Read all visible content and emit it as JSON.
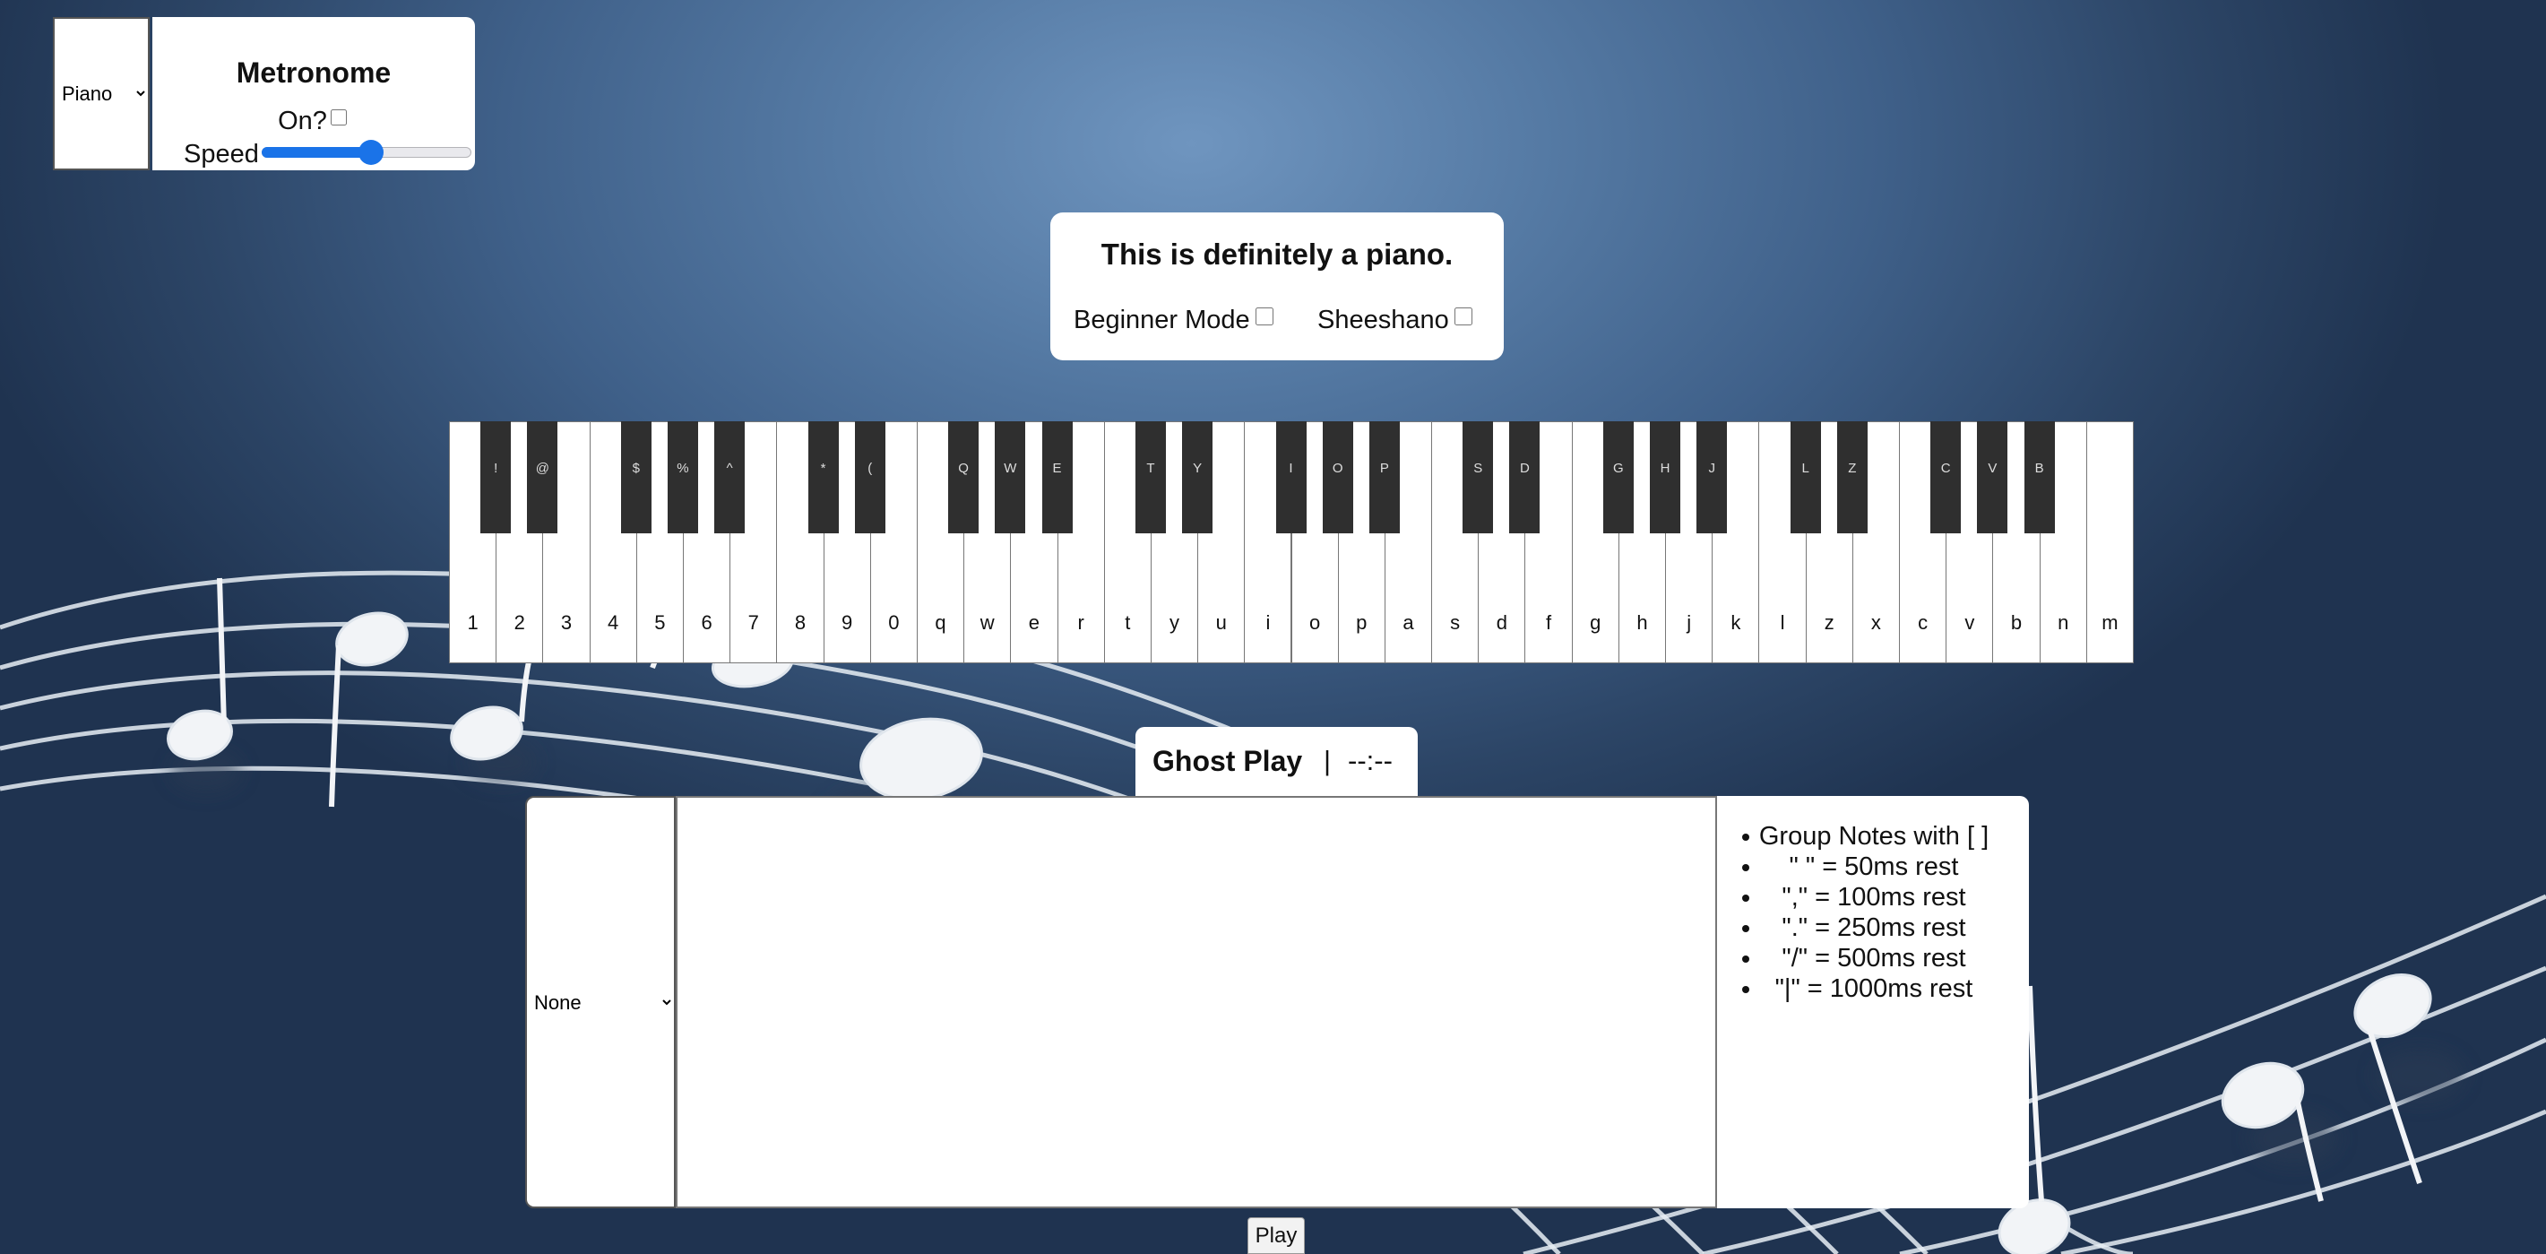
{
  "instrument_select": {
    "value": "Piano",
    "options": [
      "Piano"
    ]
  },
  "metronome": {
    "title": "Metronome",
    "on_label": "On?",
    "on_checked": false,
    "speed_label": "Speed",
    "speed_level": 0.52
  },
  "title_card": {
    "title": "This is definitely a piano.",
    "beginner_mode_label": "Beginner Mode",
    "sheeshano_label": "Sheeshano"
  },
  "piano": {
    "white_keys": [
      "1",
      "2",
      "3",
      "4",
      "5",
      "6",
      "7",
      "8",
      "9",
      "0",
      "q",
      "w",
      "e",
      "r",
      "t",
      "y",
      "u",
      "i",
      "o",
      "p",
      "a",
      "s",
      "d",
      "f",
      "g",
      "h",
      "j",
      "k",
      "l",
      "z",
      "x",
      "c",
      "v",
      "b",
      "n",
      "m"
    ],
    "black_keys": [
      {
        "label": "!",
        "after": 0
      },
      {
        "label": "@",
        "after": 1
      },
      {
        "label": "$",
        "after": 3
      },
      {
        "label": "%",
        "after": 4
      },
      {
        "label": "^",
        "after": 5
      },
      {
        "label": "*",
        "after": 7
      },
      {
        "label": "(",
        "after": 8
      },
      {
        "label": "Q",
        "after": 10
      },
      {
        "label": "W",
        "after": 11
      },
      {
        "label": "E",
        "after": 12
      },
      {
        "label": "T",
        "after": 14
      },
      {
        "label": "Y",
        "after": 15
      },
      {
        "label": "I",
        "after": 17
      },
      {
        "label": "O",
        "after": 18
      },
      {
        "label": "P",
        "after": 19
      },
      {
        "label": "S",
        "after": 21
      },
      {
        "label": "D",
        "after": 22
      },
      {
        "label": "G",
        "after": 24
      },
      {
        "label": "H",
        "after": 25
      },
      {
        "label": "J",
        "after": 26
      },
      {
        "label": "L",
        "after": 28
      },
      {
        "label": "Z",
        "after": 29
      },
      {
        "label": "C",
        "after": 31
      },
      {
        "label": "V",
        "after": 32
      },
      {
        "label": "B",
        "after": 33
      }
    ]
  },
  "ghost_play": {
    "title": "Ghost Play",
    "separator": "|",
    "time": "--:--",
    "song_select_value": "None",
    "notes_value": "",
    "legend": [
      "Group Notes with [ ]",
      "\" \" = 50ms rest",
      "\",\" = 100ms rest",
      "\".\" = 250ms rest",
      "\"/\" = 500ms rest",
      "\"|\" = 1000ms rest"
    ],
    "play_label": "Play"
  }
}
